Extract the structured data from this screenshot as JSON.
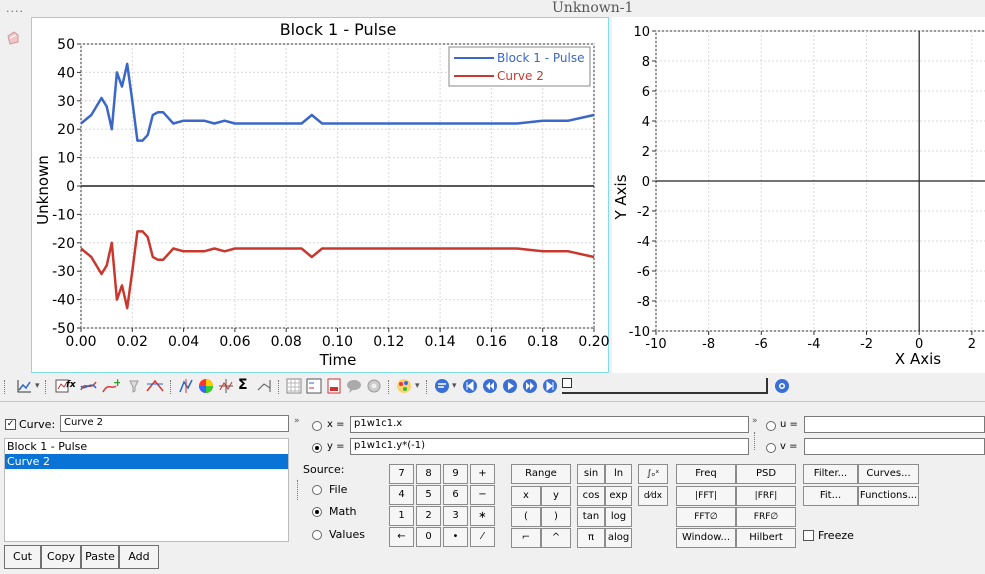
{
  "window": {
    "title": "Unknown-1",
    "dots": "...."
  },
  "plot1": {
    "title": "Block 1 - Pulse",
    "ylabel": "Unknown",
    "xlabel": "Time",
    "yticks": [
      "50",
      "40",
      "30",
      "20",
      "10",
      "0",
      "-10",
      "-20",
      "-30",
      "-40",
      "-50"
    ],
    "xticks": [
      "0.00",
      "0.02",
      "0.04",
      "0.06",
      "0.08",
      "0.10",
      "0.12",
      "0.14",
      "0.16",
      "0.18",
      "0.20"
    ],
    "legend": [
      "Block 1 - Pulse",
      "Curve 2"
    ],
    "colors": {
      "series1": "#3a67c8",
      "series2": "#c8382e"
    }
  },
  "plot2": {
    "ylabel": "Y Axis",
    "xlabel": "X Axis",
    "yticks": [
      "10",
      "8",
      "6",
      "4",
      "2",
      "0",
      "-2",
      "-4",
      "-6",
      "-8",
      "-10"
    ],
    "xticks": [
      "-10",
      "-8",
      "-6",
      "-4",
      "-2",
      "0",
      "2"
    ]
  },
  "chart_data": [
    {
      "type": "line",
      "title": "Block 1 - Pulse",
      "xlabel": "Time",
      "ylabel": "Unknown",
      "xlim": [
        0.0,
        0.2
      ],
      "ylim": [
        -50,
        50
      ],
      "grid": true,
      "legend_position": "top-right",
      "series": [
        {
          "name": "Block 1 - Pulse",
          "x": [
            0.0,
            0.004,
            0.008,
            0.01,
            0.012,
            0.014,
            0.016,
            0.018,
            0.02,
            0.022,
            0.024,
            0.026,
            0.028,
            0.03,
            0.032,
            0.034,
            0.036,
            0.04,
            0.044,
            0.048,
            0.052,
            0.056,
            0.06,
            0.064,
            0.07,
            0.076,
            0.08,
            0.086,
            0.09,
            0.094,
            0.1,
            0.11,
            0.12,
            0.13,
            0.14,
            0.15,
            0.16,
            0.17,
            0.18,
            0.19,
            0.2
          ],
          "y": [
            22,
            25,
            31,
            28,
            20,
            40,
            35,
            43,
            30,
            16,
            16,
            18,
            25,
            26,
            26,
            24,
            22,
            23,
            23,
            23,
            22,
            23,
            22,
            22,
            22,
            22,
            22,
            22,
            25,
            22,
            22,
            22,
            22,
            22,
            22,
            22,
            22,
            22,
            23,
            23,
            25
          ]
        },
        {
          "name": "Curve 2",
          "x": [
            0.0,
            0.004,
            0.008,
            0.01,
            0.012,
            0.014,
            0.016,
            0.018,
            0.02,
            0.022,
            0.024,
            0.026,
            0.028,
            0.03,
            0.032,
            0.034,
            0.036,
            0.04,
            0.044,
            0.048,
            0.052,
            0.056,
            0.06,
            0.064,
            0.07,
            0.076,
            0.08,
            0.086,
            0.09,
            0.094,
            0.1,
            0.11,
            0.12,
            0.13,
            0.14,
            0.15,
            0.16,
            0.17,
            0.18,
            0.19,
            0.2
          ],
          "y": [
            -22,
            -25,
            -31,
            -28,
            -20,
            -40,
            -35,
            -43,
            -30,
            -16,
            -16,
            -18,
            -25,
            -26,
            -26,
            -24,
            -22,
            -23,
            -23,
            -23,
            -22,
            -23,
            -22,
            -22,
            -22,
            -22,
            -22,
            -22,
            -25,
            -22,
            -22,
            -22,
            -22,
            -22,
            -22,
            -22,
            -22,
            -22,
            -23,
            -23,
            -25
          ]
        }
      ]
    },
    {
      "type": "line",
      "xlabel": "X Axis",
      "ylabel": "Y Axis",
      "xlim": [
        -10,
        2.5
      ],
      "ylim": [
        -10,
        10
      ],
      "grid": true,
      "series": []
    }
  ],
  "panel": {
    "curve_label": "Curve:",
    "curve_value": "Curve 2",
    "curves": [
      "Block 1 - Pulse",
      "Curve 2"
    ],
    "selected_curve_index": 1,
    "x_label": "x =",
    "x_value": "p1w1c1.x",
    "y_label": "y =",
    "y_value": "p1w1c1.y*(-1)",
    "u_label": "u =",
    "v_label": "v =",
    "source_label": "Source:",
    "source_options": [
      "File",
      "Math",
      "Values"
    ],
    "source_selected": "Math",
    "buttons": {
      "cut": "Cut",
      "copy": "Copy",
      "paste": "Paste",
      "add": "Add"
    },
    "keypad": [
      "7",
      "8",
      "9",
      "+",
      "4",
      "5",
      "6",
      "−",
      "1",
      "2",
      "3",
      "∗",
      "←",
      "0",
      "•",
      "⁄"
    ],
    "ops": [
      "Range",
      "x",
      "y",
      "(",
      ")",
      "⌐",
      "^"
    ],
    "funcs": [
      "sin",
      "ln",
      "cos",
      "exp",
      "tan",
      "log",
      "π",
      "alog"
    ],
    "calc1": "∫ₒˣ",
    "calc2": "d⁄dx",
    "signal": [
      "Freq",
      "PSD",
      "|FFT|",
      "|FRF|",
      "FFT∅",
      "FRF∅",
      "Window...",
      "Hilbert"
    ],
    "freeze_label": "Freeze",
    "tools": [
      "Filter...",
      "Curves...",
      "Fit...",
      "Functions..."
    ]
  }
}
